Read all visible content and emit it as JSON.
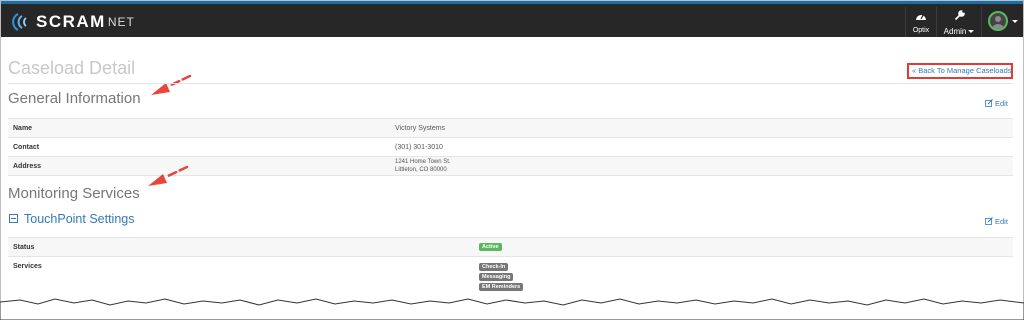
{
  "brand": {
    "name_main": "SCRAM",
    "name_suffix": "NET"
  },
  "nav": {
    "optix_label": "Optix",
    "admin_label": "Admin"
  },
  "page": {
    "title": "Caseload Detail",
    "back_link": "« Back To Manage Caseloads"
  },
  "general": {
    "title": "General Information",
    "edit_label": "Edit",
    "rows": [
      {
        "key": "Name",
        "value": "Victory Systems"
      },
      {
        "key": "Contact",
        "value": "(301) 301-3010"
      },
      {
        "key": "Address",
        "value_line1": "1241 Home Town St.",
        "value_line2": "Littleton, CO 80000"
      }
    ]
  },
  "monitoring": {
    "title": "Monitoring Services",
    "touchpoint": {
      "title": "TouchPoint Settings",
      "edit_label": "Edit",
      "status_key": "Status",
      "status_value": "Active",
      "services_key": "Services",
      "services": [
        "Check-In",
        "Messaging",
        "EM Reminders"
      ]
    }
  },
  "colors": {
    "accent": "#337ab7",
    "topbar": "#272727",
    "status_active": "#5cb85c",
    "service_badge": "#777777",
    "highlight": "#e23a36",
    "arrow": "#e8453c"
  }
}
